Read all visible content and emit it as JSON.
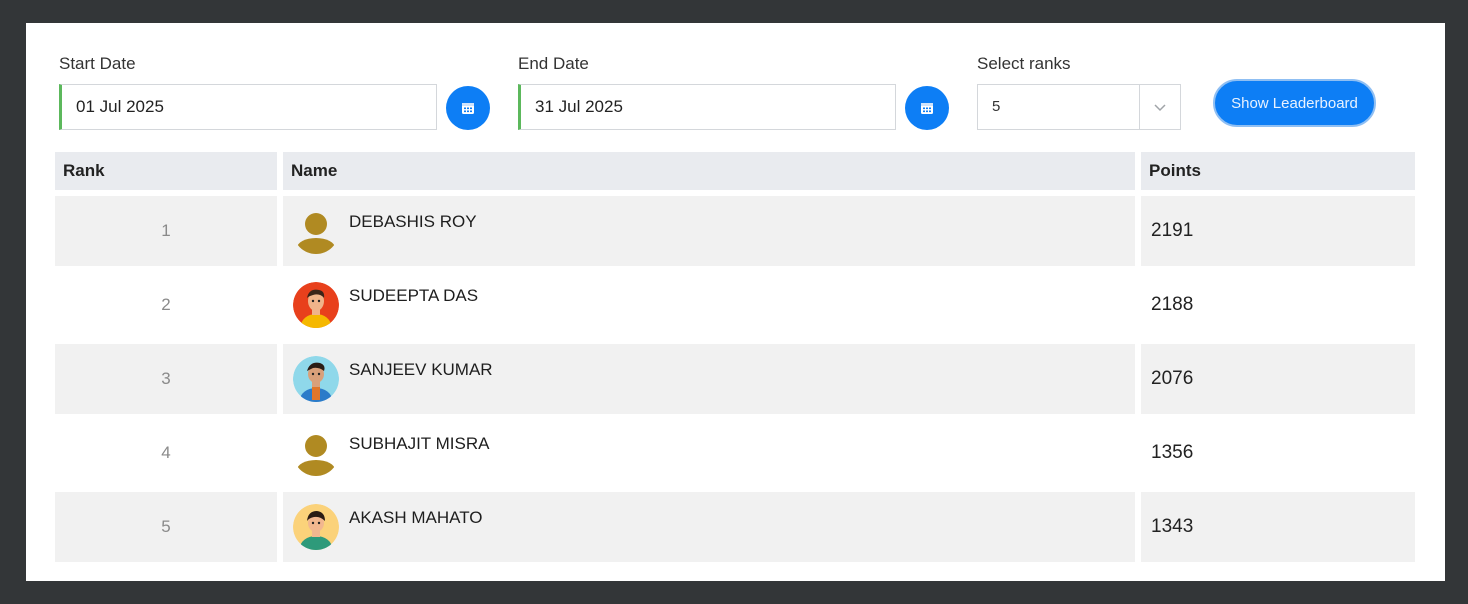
{
  "filters": {
    "start_label": "Start Date",
    "start_value": "01 Jul 2025",
    "end_label": "End Date",
    "end_value": "31 Jul 2025",
    "ranks_label": "Select ranks",
    "ranks_value": "5",
    "show_button": "Show Leaderboard"
  },
  "table": {
    "headers": {
      "rank": "Rank",
      "name": "Name",
      "points": "Points"
    },
    "rows": [
      {
        "rank": "1",
        "name": "DEBASHIS ROY",
        "points": "2191",
        "avatar": "default-avatar-icon"
      },
      {
        "rank": "2",
        "name": "SUDEEPTA DAS",
        "points": "2188",
        "avatar": "cartoon-avatar-red"
      },
      {
        "rank": "3",
        "name": "SANJEEV KUMAR",
        "points": "2076",
        "avatar": "cartoon-avatar-blue"
      },
      {
        "rank": "4",
        "name": "SUBHAJIT MISRA",
        "points": "1356",
        "avatar": "default-avatar-icon"
      },
      {
        "rank": "5",
        "name": "AKASH MAHATO",
        "points": "1343",
        "avatar": "cartoon-avatar-yellow"
      }
    ]
  },
  "colors": {
    "accent": "#0d7ef5",
    "input_focus": "#5cb85c",
    "header_bg": "#e9ebef",
    "row_alt": "#f1f1f1",
    "frame": "#333638"
  }
}
